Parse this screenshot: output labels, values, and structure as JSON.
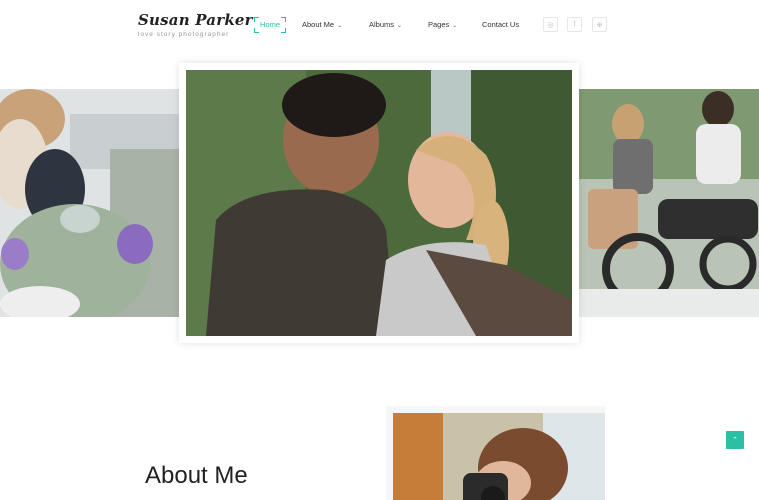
{
  "logo": {
    "title": "Susan Parker",
    "subtitle": "love story photographer"
  },
  "nav": {
    "home": "Home",
    "about": "About Me",
    "albums": "Albums",
    "pages": "Pages",
    "contact": "Contact Us",
    "chevron": "⌄"
  },
  "social": [
    {
      "icon": "instagram-icon",
      "glyph": "◎"
    },
    {
      "icon": "facebook-icon",
      "glyph": "f"
    },
    {
      "icon": "dribbble-icon",
      "glyph": "⊕"
    }
  ],
  "about": {
    "heading": "About Me"
  },
  "scroll_top": {
    "glyph": "⌃"
  },
  "colors": {
    "accent": "#2bbfa4",
    "text": "#222222"
  }
}
